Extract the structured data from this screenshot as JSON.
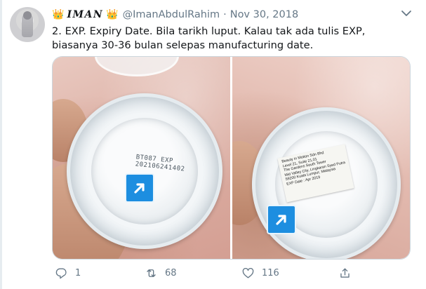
{
  "tweet": {
    "crown_left": "👑",
    "display_name": "𝑰𝑴𝑨𝑵",
    "crown_right": "👑",
    "handle": "@ImanAbdulRahim",
    "separator": "·",
    "date": "Nov 30, 2018",
    "text": "2. EXP. Expiry Date. Bila tarikh luput. Kalau tak ada tulis EXP, biasanya 30-36 bulan selepas manufacturing date.",
    "media": {
      "left_photo": {
        "stamp_line1": "BT087 EXP",
        "stamp_line2": "202106241402"
      },
      "right_photo": {
        "label_lines": [
          "Beauty in Motion Sdn Bhd",
          "Level 21, Suite 21.01",
          "The Gardens South Tower",
          "Mid Valley City, Lingkaran Syed Putra",
          "59200 Kuala Lumpur, Malaysia",
          "EXP Date : Apr 2019"
        ]
      }
    },
    "actions": {
      "reply_count": "1",
      "retweet_count": "68",
      "like_count": "116"
    }
  },
  "colors": {
    "accent": "#1da1f2",
    "muted": "#657786",
    "badge": "#1d8ee0",
    "crown": "#f4b400"
  },
  "icons": [
    "caret-down-icon",
    "expand-icon",
    "reply-icon",
    "retweet-icon",
    "like-icon",
    "share-icon"
  ]
}
